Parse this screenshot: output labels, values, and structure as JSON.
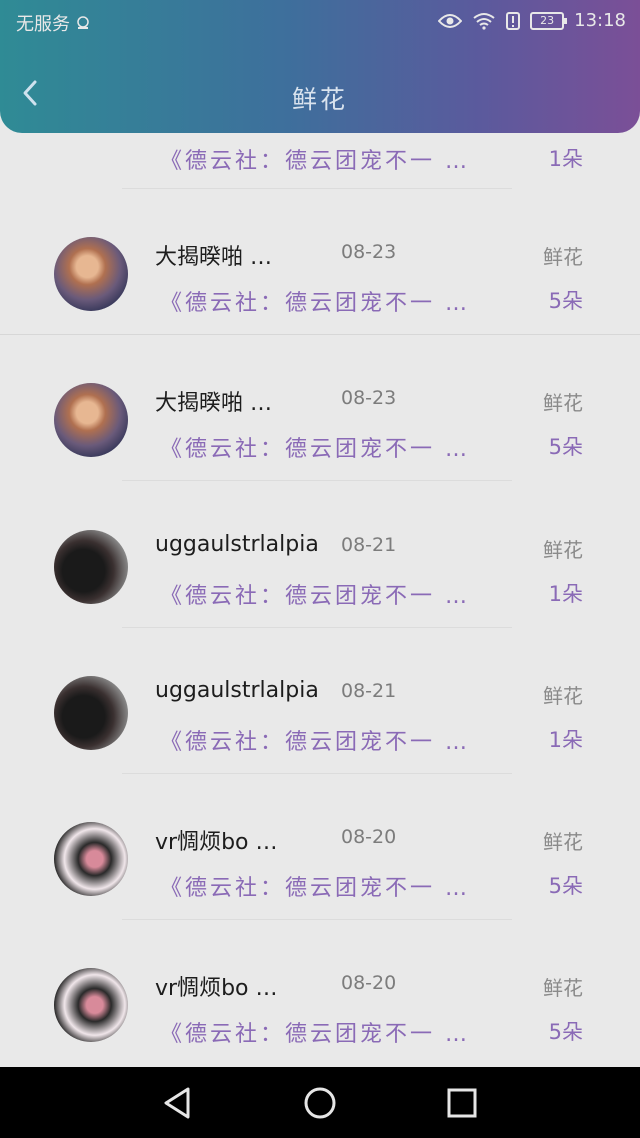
{
  "status_bar": {
    "carrier": "无服务",
    "battery": "23",
    "time": "13:18"
  },
  "header": {
    "title": "鲜花"
  },
  "partial_row": {
    "song": "《德云社：德云团宠不一 …",
    "count": "1朵"
  },
  "rows": [
    {
      "name": "大揭暌啪 …",
      "date": "08-23",
      "gift": "鲜花",
      "song": "《德云社：德云团宠不一 …",
      "count": "5朵"
    },
    {
      "name": "大揭暌啪 …",
      "date": "08-23",
      "gift": "鲜花",
      "song": "《德云社：德云团宠不一 …",
      "count": "5朵"
    },
    {
      "name": "uggaulstrlalpia",
      "date": "08-21",
      "gift": "鲜花",
      "song": "《德云社：德云团宠不一 …",
      "count": "1朵"
    },
    {
      "name": "uggaulstrlalpia",
      "date": "08-21",
      "gift": "鲜花",
      "song": "《德云社：德云团宠不一 …",
      "count": "1朵"
    },
    {
      "name": "vr惆烦bo …",
      "date": "08-20",
      "gift": "鲜花",
      "song": "《德云社：德云团宠不一 …",
      "count": "5朵"
    },
    {
      "name": "vr惆烦bo …",
      "date": "08-20",
      "gift": "鲜花",
      "song": "《德云社：德云团宠不一 …",
      "count": "5朵"
    }
  ]
}
